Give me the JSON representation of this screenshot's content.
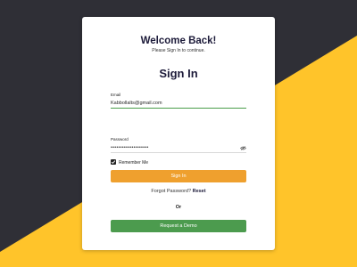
{
  "colors": {
    "dark_bg": "#2f2f36",
    "accent_yellow": "#ffc42a",
    "signin_button": "#efa02e",
    "demo_button": "#4c9b4e",
    "email_underline": "#4a9c4a"
  },
  "header": {
    "title": "Welcome Back!",
    "subtitle": "Please Sign In to continue."
  },
  "form": {
    "heading": "Sign In",
    "email": {
      "label": "Email",
      "value": "Kabbollalts@gmail.com"
    },
    "password": {
      "label": "Password",
      "masked_value": "••••••••••••••••••••",
      "toggle_icon": "eye-icon"
    },
    "remember": {
      "label": "Remember Me",
      "checked": true
    },
    "submit_label": "Sign In",
    "forgot_text": "Forgot Password?",
    "reset_link": "Reset",
    "or_text": "Or",
    "demo_label": "Request a Demo"
  }
}
